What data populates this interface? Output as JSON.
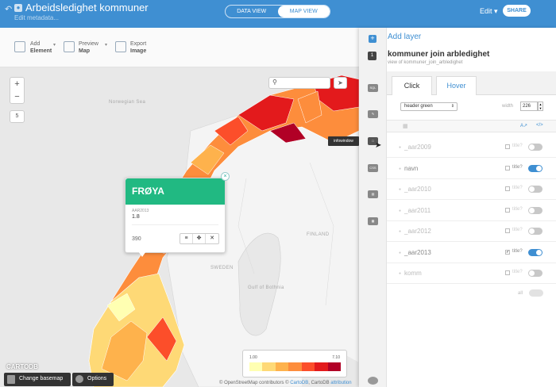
{
  "header": {
    "title": "Arbeidsledighet kommuner",
    "subtitle": "Edit metadata...",
    "view_tabs": [
      "DATA VIEW",
      "MAP VIEW"
    ],
    "edit_label": "Edit",
    "share_label": "SHARE"
  },
  "toolbar": {
    "add_top": "Add",
    "add_bottom": "Element",
    "preview_top": "Preview",
    "preview_bottom": "Map",
    "export_top": "Export",
    "export_bottom": "Image"
  },
  "map": {
    "zoom_level": "5",
    "places": [
      "Norwegian Sea",
      "FINLAND",
      "SWEDEN",
      "Gulf of Bothnia"
    ],
    "attribution_prefix": "© OpenStreetMap contributors © ",
    "attribution_link": "CartoDB",
    "attribution_suffix": ", CartoDB ",
    "attribution_link2": "attribution",
    "logo": "CARTODB",
    "change_basemap": "Change basemap",
    "options": "Options",
    "tooltip": "infowindow"
  },
  "infowindow": {
    "title": "FRØYA",
    "field_label": "AAR2013",
    "field_value": "1.8",
    "count": "390"
  },
  "legend": {
    "min": "1.00",
    "max": "7.10",
    "colors": [
      "#ffffb2",
      "#fed976",
      "#feb24c",
      "#fd8d3c",
      "#fc4e2a",
      "#e31a1c",
      "#b10026"
    ]
  },
  "panel": {
    "add_layer": "Add layer",
    "layer_index": "1",
    "layer_name": "kommuner join arbledighet",
    "layer_sub": "view of kommuner_join_arbledighet",
    "tab_click": "Click",
    "tab_hover": "Hover",
    "template": "header green",
    "width_label": "width",
    "width_value": "226",
    "all_label": "all",
    "fields": [
      {
        "name": "_aar2009",
        "title": "title?",
        "title_checked": false,
        "on": false
      },
      {
        "name": "navn",
        "title": "title?",
        "title_checked": false,
        "on": true
      },
      {
        "name": "_aar2010",
        "title": "title?",
        "title_checked": false,
        "on": false
      },
      {
        "name": "_aar2011",
        "title": "title?",
        "title_checked": false,
        "on": false
      },
      {
        "name": "_aar2012",
        "title": "title?",
        "title_checked": false,
        "on": false
      },
      {
        "name": "_aar2013",
        "title": "title?",
        "title_checked": true,
        "on": true
      },
      {
        "name": "komm",
        "title": "title?",
        "title_checked": false,
        "on": false
      }
    ]
  }
}
